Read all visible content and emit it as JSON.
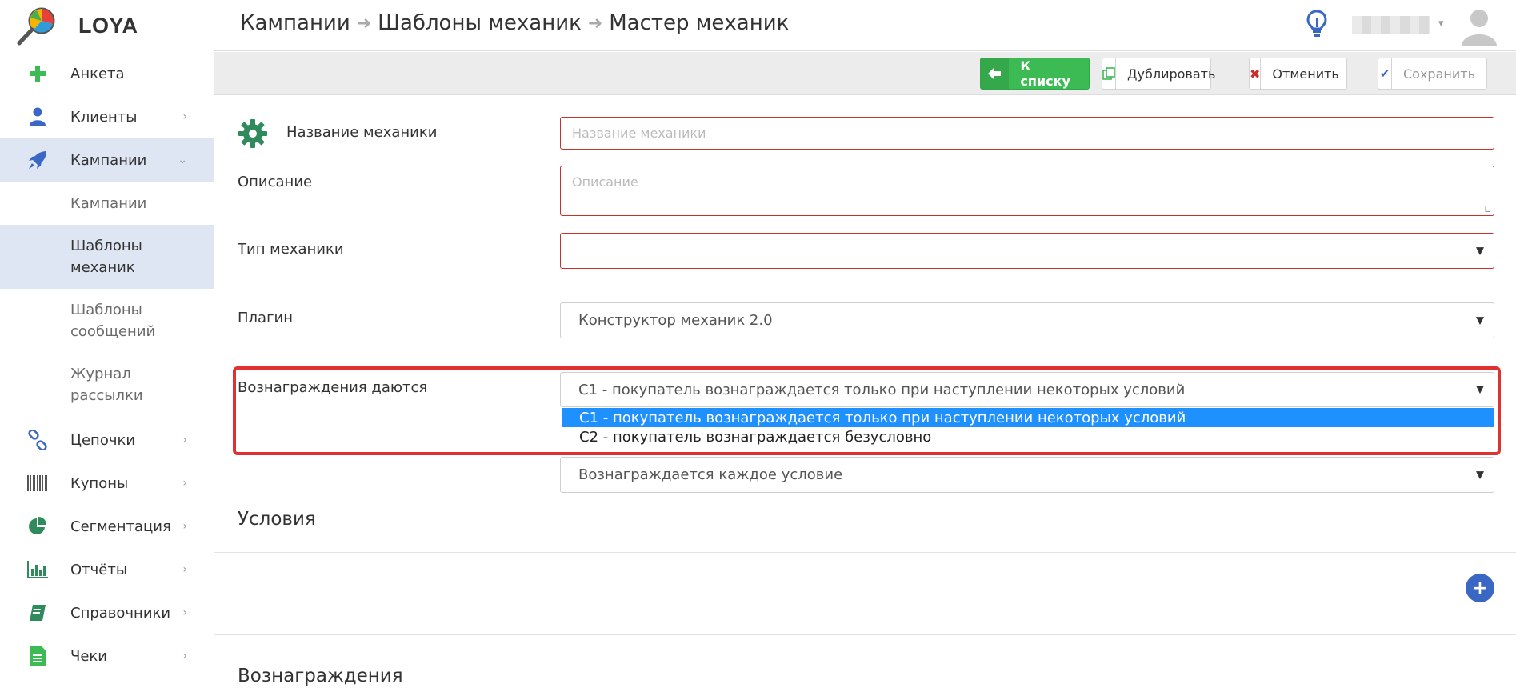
{
  "app": {
    "name": "LOYA"
  },
  "sidebar": {
    "items": [
      {
        "label": "Анкета",
        "icon": "plus-icon"
      },
      {
        "label": "Клиенты",
        "icon": "user-icon"
      },
      {
        "label": "Кампании",
        "icon": "rocket-icon"
      },
      {
        "label": "Цепочки",
        "icon": "chain-icon"
      },
      {
        "label": "Купоны",
        "icon": "barcode-icon"
      },
      {
        "label": "Сегментация",
        "icon": "pie-icon"
      },
      {
        "label": "Отчёты",
        "icon": "bar-chart-icon"
      },
      {
        "label": "Справочники",
        "icon": "book-icon"
      },
      {
        "label": "Чеки",
        "icon": "receipt-icon"
      }
    ],
    "sub_items": [
      {
        "label": "Кампании"
      },
      {
        "label": "Шаблоны механик"
      },
      {
        "label": "Шаблоны сообщений"
      },
      {
        "label": "Журнал рассылки"
      }
    ]
  },
  "header": {
    "breadcrumb": [
      "Кампании",
      "Шаблоны механик",
      "Мастер механик"
    ]
  },
  "toolbar": {
    "list_label": "К списку",
    "duplicate_label": "Дублировать",
    "cancel_label": "Отменить",
    "save_label": "Сохранить"
  },
  "form": {
    "name_label": "Название механики",
    "name_placeholder": "Название механики",
    "description_label": "Описание",
    "description_placeholder": "Описание",
    "type_label": "Тип механики",
    "type_value": "",
    "plugin_label": "Плагин",
    "plugin_value": "Конструктор механик 2.0",
    "rewards_given_label": "Вознаграждения даются",
    "rewards_given_value": "C1 - покупатель вознаграждается только при наступлении некоторых условий",
    "rewards_options": [
      "C1 - покупатель вознаграждается только при наступлении некоторых условий",
      "C2 - покупатель вознаграждается безусловно"
    ],
    "reward_mode_value": "Вознаграждается каждое условие"
  },
  "sections": {
    "conditions_title": "Условия",
    "rewards_title": "Вознаграждения"
  },
  "colors": {
    "accent_green": "#3cba54",
    "error_red": "#c9302c",
    "highlight_red": "#e03131",
    "selected_blue": "#1e90ff",
    "active_nav": "#dfe6f3",
    "add_blue": "#3a66c4"
  }
}
